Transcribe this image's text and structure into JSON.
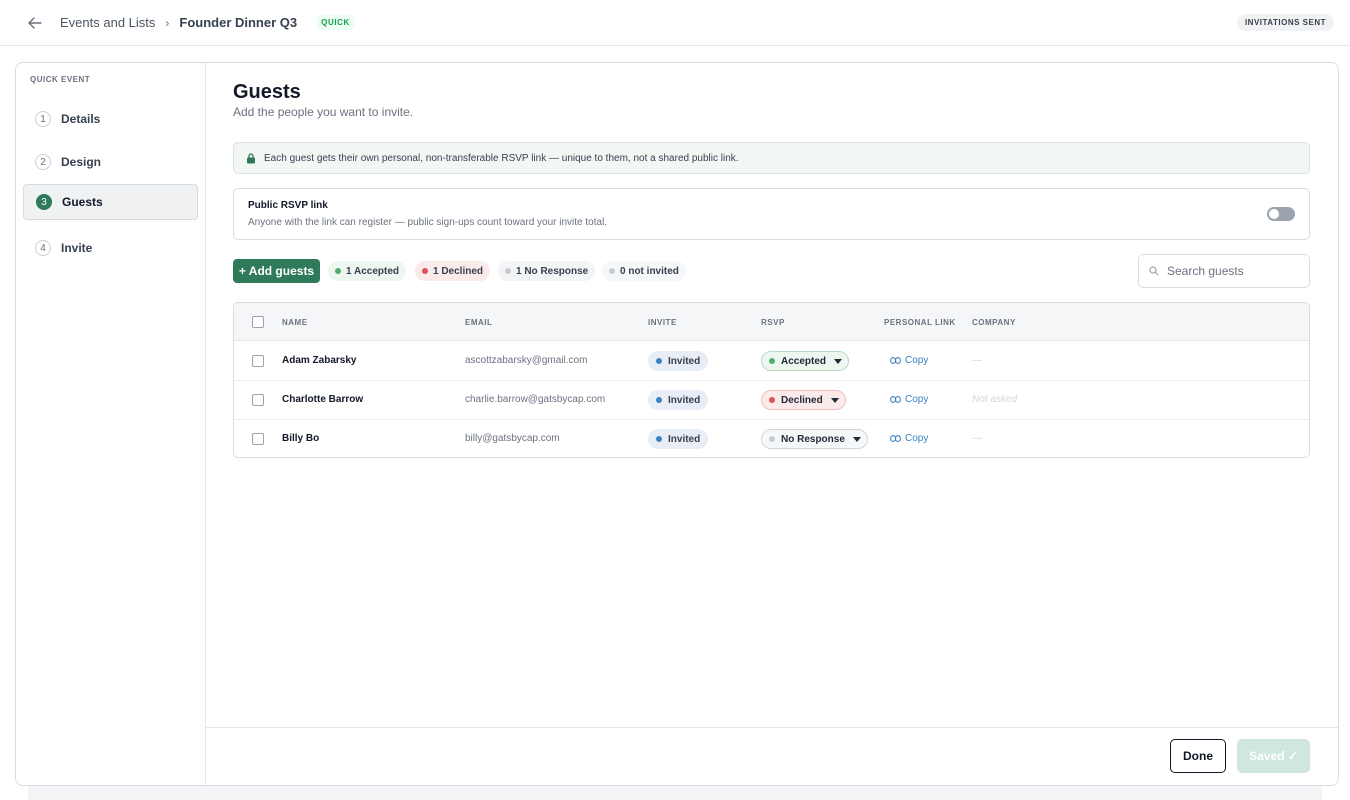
{
  "header": {
    "breadcrumb_parent": "Events and Lists",
    "breadcrumb_separator": "›",
    "breadcrumb_current": "Founder Dinner Q3",
    "badge": "QUICK",
    "status": "INVITATIONS SENT"
  },
  "sidebar": {
    "title": "QUICK EVENT",
    "steps": [
      {
        "num": "1",
        "label": "Details"
      },
      {
        "num": "2",
        "label": "Design"
      },
      {
        "num": "3",
        "label": "Guests"
      },
      {
        "num": "4",
        "label": "Invite"
      }
    ],
    "active_step": "Guests"
  },
  "main": {
    "title": "Guests",
    "subtitle": "Add the people you want to invite.",
    "info_banner": "Each guest gets their own personal, non-transferable RSVP link — unique to them, not a shared public link.",
    "public_link": {
      "title": "Public RSVP link",
      "description": "Anyone with the link can register — public sign-ups count toward your invite total.",
      "enabled": false
    },
    "add_button": "+ Add guests",
    "chips": [
      {
        "label": "1 Accepted",
        "color": "#4caf6e",
        "bg": "#eef6f0"
      },
      {
        "label": "1 Declined",
        "color": "#e0505a",
        "bg": "#fbeaea"
      },
      {
        "label": "1 No Response",
        "color": "#c7cbd1",
        "bg": "#f3f4f6"
      },
      {
        "label": "0 not invited",
        "color": "#c7cbd1",
        "bg": "#f6f7f8"
      }
    ],
    "search_placeholder": "Search guests",
    "table": {
      "columns": [
        "NAME",
        "EMAIL",
        "INVITE",
        "RSVP",
        "PERSONAL LINK",
        "COMPANY"
      ],
      "rows": [
        {
          "name": "Adam Zabarsky",
          "email": "ascottzabarsky@gmail.com",
          "invite": "Invited",
          "rsvp": "Accepted",
          "link": "Copy",
          "company": "—"
        },
        {
          "name": "Charlotte Barrow",
          "email": "charlie.barrow@gatsbycap.com",
          "invite": "Invited",
          "rsvp": "Declined",
          "link": "Copy",
          "company": "Not asked"
        },
        {
          "name": "Billy Bo",
          "email": "billy@gatsbycap.com",
          "invite": "Invited",
          "rsvp": "No Response",
          "link": "Copy",
          "company": "—"
        }
      ]
    }
  },
  "footer": {
    "done": "Done",
    "saved": "Saved ✓"
  },
  "colors": {
    "primary": "#2f7a5a",
    "invite_dot": "#3b82c4",
    "accepted": "#4caf6e",
    "declined": "#e0505a",
    "no_response": "#c7cbd1"
  }
}
